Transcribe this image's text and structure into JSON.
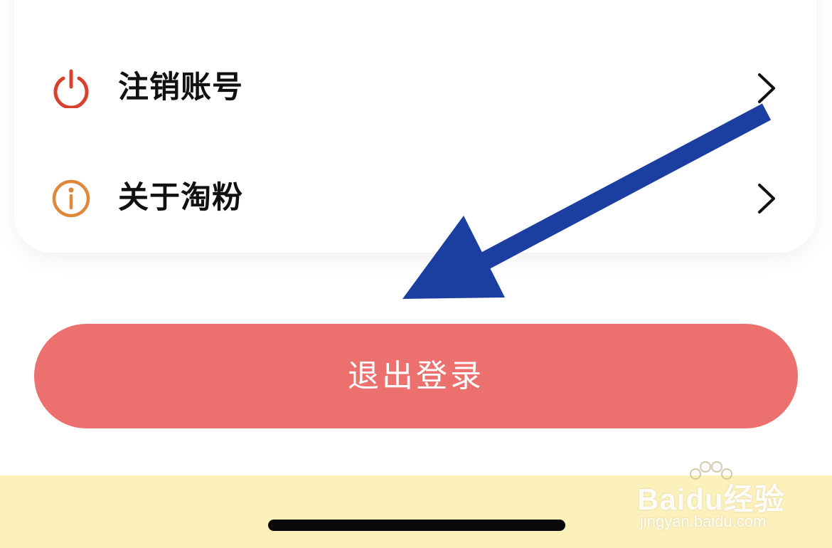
{
  "settings": {
    "items": [
      {
        "label": "注销账号",
        "icon": "power-icon",
        "color": "#d9412f"
      },
      {
        "label": "关于淘粉",
        "icon": "info-icon",
        "color": "#e0883a"
      }
    ]
  },
  "logout": {
    "label": "退出登录",
    "color": "#ec716e"
  },
  "annotation": {
    "arrow_color": "#1b3fa0"
  },
  "watermark": {
    "brand": "Baidu经验",
    "url": "jingyan.baidu.com"
  }
}
